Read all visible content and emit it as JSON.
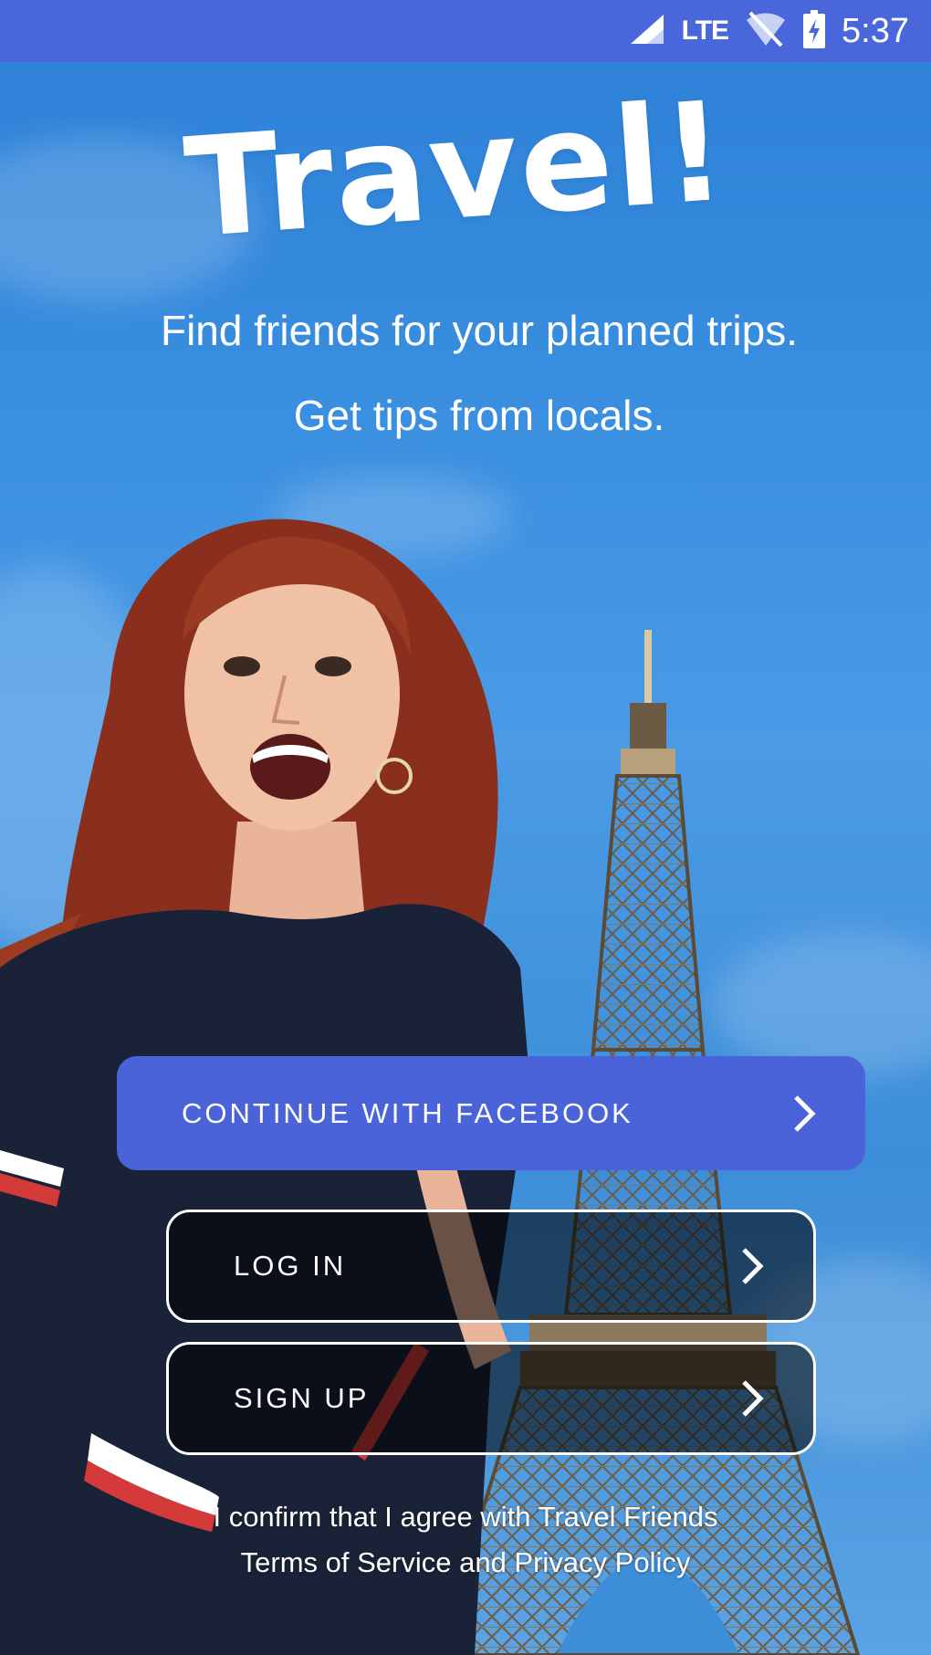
{
  "status_bar": {
    "network": "LTE",
    "time": "5:37",
    "signal_icon": "cell-signal-icon",
    "wifi_icon": "wifi-off-icon",
    "battery_icon": "battery-charging-icon"
  },
  "header": {
    "title": "Travel!",
    "tagline_1": "Find friends for your planned trips.",
    "tagline_2": "Get tips from locals."
  },
  "actions": {
    "facebook_label": "CONTINUE WITH FACEBOOK",
    "login_label": "LOG IN",
    "signup_label": "SIGN UP",
    "chevron_icon": "chevron-right-icon"
  },
  "legal": {
    "line_1": "I confirm that I agree with Travel Friends",
    "line_2": "Terms of Service and Privacy Policy"
  },
  "colors": {
    "brand": "#4a63d9",
    "status_bar": "#4a66db",
    "sky": "#3a8fe0"
  }
}
